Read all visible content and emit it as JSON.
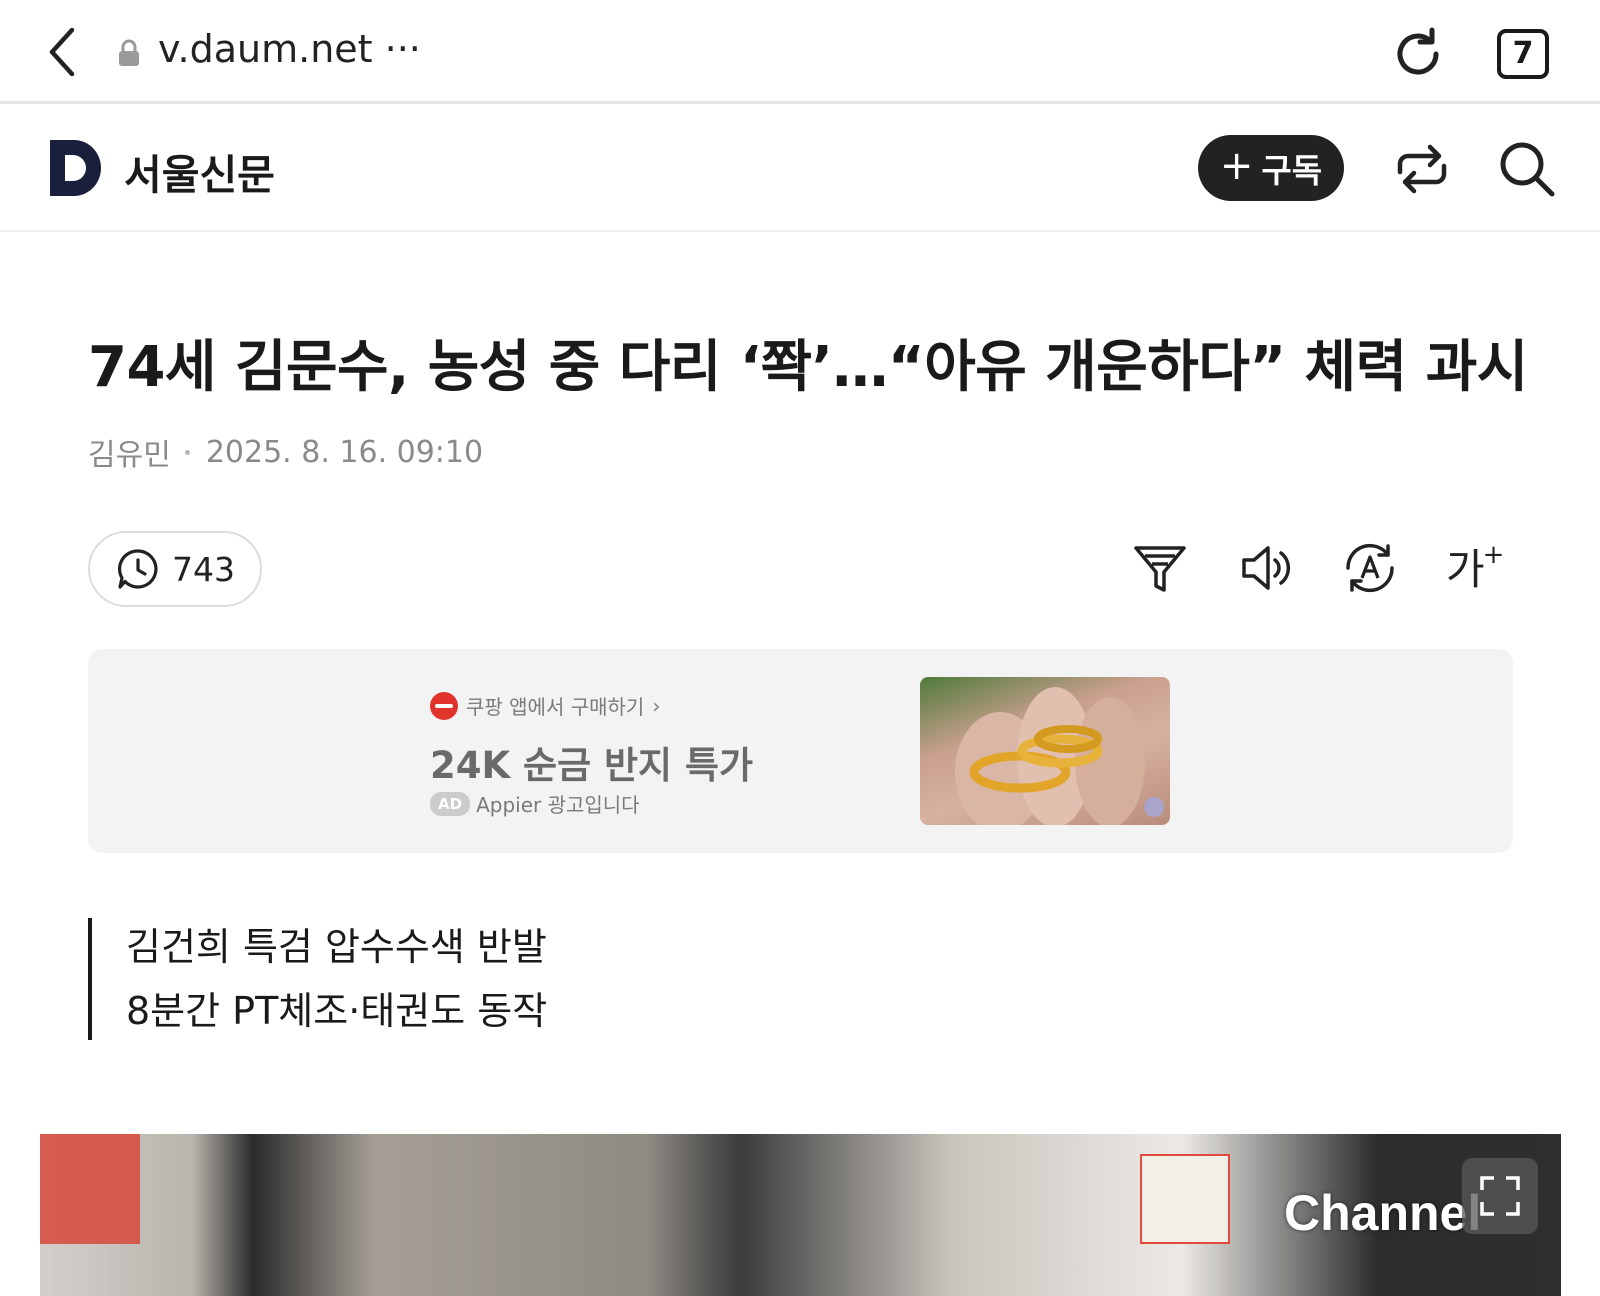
{
  "browser": {
    "url": "v.daum.net ···",
    "tab_count": "7"
  },
  "header": {
    "press_name": "서울신문",
    "subscribe_label": "구독"
  },
  "article": {
    "title": "74세 김문수, 농성 중 다리 ‘쫙’…“아유 개운하다” 체력 과시",
    "author": "김유민",
    "datetime": "2025. 8. 16. 09:10",
    "comment_count": "743",
    "summary": [
      "김건희 특검 압수수색 반발",
      "8분간 PT체조·태권도 동작"
    ],
    "image_watermark": "Channel"
  },
  "tools": {
    "font_size_label": "가"
  },
  "ad": {
    "source": "쿠팡 앱에서 구매하기",
    "headline": "24K 순금 반지 특가",
    "badge": "AD",
    "label": "Appier 광고입니다"
  },
  "colors": {
    "subscribe_bg": "#222222",
    "ad_bg": "#f3f3f3",
    "coupang_red": "#e0342c",
    "meta_gray": "#8a8a8a"
  },
  "icons": [
    "back-icon",
    "lock-icon",
    "reload-icon",
    "daum-logo",
    "plus-icon",
    "share-icon",
    "search-icon",
    "comment-icon",
    "filter-icon",
    "speaker-icon",
    "translate-icon",
    "expand-icon"
  ]
}
